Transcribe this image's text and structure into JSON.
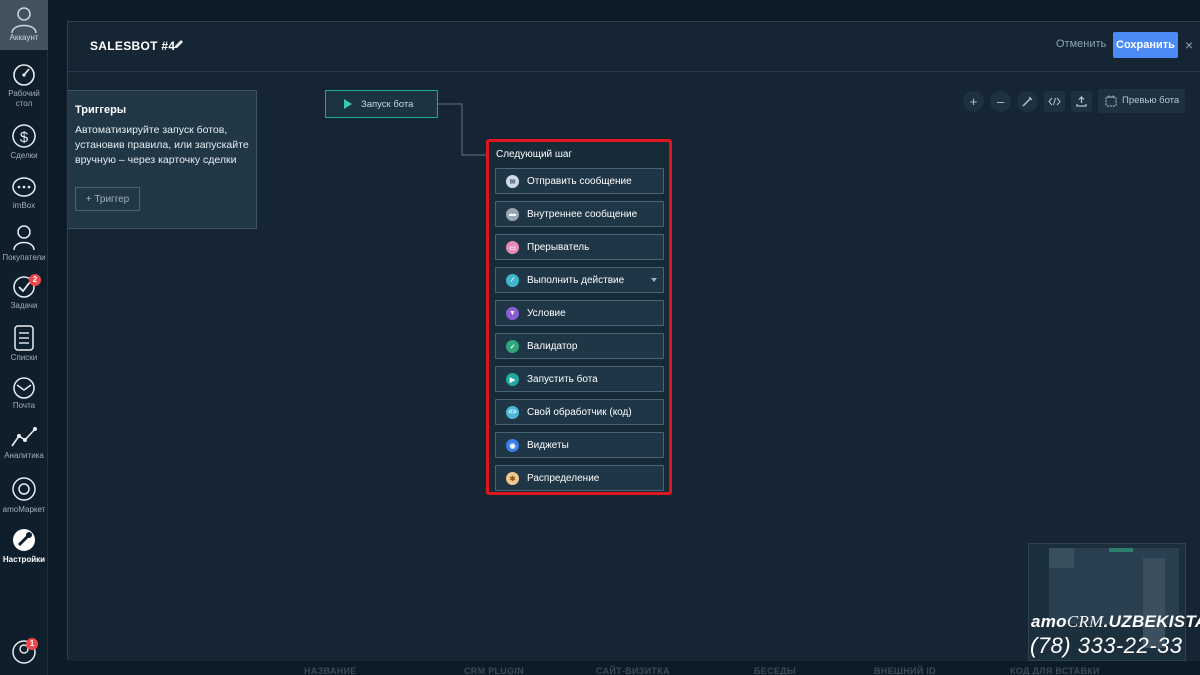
{
  "sidebar": {
    "account_label": "Аккаунт",
    "items": [
      {
        "label": "Рабочий стол",
        "icon": "dashboard-icon"
      },
      {
        "label": "Сделки",
        "icon": "dollar-icon"
      },
      {
        "label": "imBox",
        "icon": "chat-icon"
      },
      {
        "label": "Покупатели",
        "icon": "customers-icon"
      },
      {
        "label": "Задачи",
        "icon": "tasks-icon",
        "badge": "2"
      },
      {
        "label": "Списки",
        "icon": "lists-icon"
      },
      {
        "label": "Почта",
        "icon": "mail-icon"
      },
      {
        "label": "Аналитика",
        "icon": "analytics-icon"
      },
      {
        "label": "amoМаркет",
        "icon": "market-icon"
      },
      {
        "label": "Настройки",
        "icon": "settings-icon",
        "active": true
      }
    ],
    "notifications_badge": "1"
  },
  "background_columns": [
    "НАЗВАНИЕ",
    "CRM PLUGIN",
    "САЙТ-ВИЗИТКА",
    "БЕСЕДЫ",
    "ВНЕШНИЙ ID",
    "КОД ДЛЯ ВСТАВКИ"
  ],
  "header": {
    "title": "SALESBOT #4",
    "cancel_label": "Отменить",
    "save_label": "Сохранить",
    "close_label": "×"
  },
  "trigger_panel": {
    "title": "Триггеры",
    "description": "Автоматизируйте запуск ботов, установив правила, или запускайте вручную – через карточку сделки",
    "add_label": "+ Триггер"
  },
  "start_node": {
    "label": "Запуск бота"
  },
  "next_step": {
    "header": "Следующий шаг",
    "items": [
      {
        "label": "Отправить сообщение",
        "icon": "message-icon",
        "color": "#cfd9e3"
      },
      {
        "label": "Внутреннее сообщение",
        "icon": "internal-message-icon",
        "color": "#9aa6b2"
      },
      {
        "label": "Прерыватель",
        "icon": "interrupter-icon",
        "color": "#e58bb6"
      },
      {
        "label": "Выполнить действие",
        "icon": "action-icon",
        "color": "#3fb6c9",
        "has_dropdown": true
      },
      {
        "label": "Условие",
        "icon": "condition-icon",
        "color": "#8a5cd6"
      },
      {
        "label": "Валидатор",
        "icon": "validator-icon",
        "color": "#2ea87a"
      },
      {
        "label": "Запустить бота",
        "icon": "run-bot-icon",
        "color": "#22a8a2"
      },
      {
        "label": "Свой обработчик (код)",
        "icon": "code-icon",
        "color": "#4fb6d8"
      },
      {
        "label": "Виджеты",
        "icon": "widgets-icon",
        "color": "#3d7ff0"
      },
      {
        "label": "Распределение",
        "icon": "distribution-icon",
        "color": "#f1c890"
      }
    ]
  },
  "toolbar": {
    "zoom_in": "+",
    "zoom_out": "–",
    "preview_label": "Превью бота"
  },
  "watermark": {
    "brand_prefix": "amo",
    "brand_crm": "CRM",
    "brand_suffix": ".UZBEKISTAN",
    "phone": "(78) 333-22-33"
  },
  "colors": {
    "accent_blue": "#4c8bf5",
    "highlight_red": "#e0161e",
    "start_node_green": "#25a58e",
    "badge_red": "#f0474b"
  }
}
